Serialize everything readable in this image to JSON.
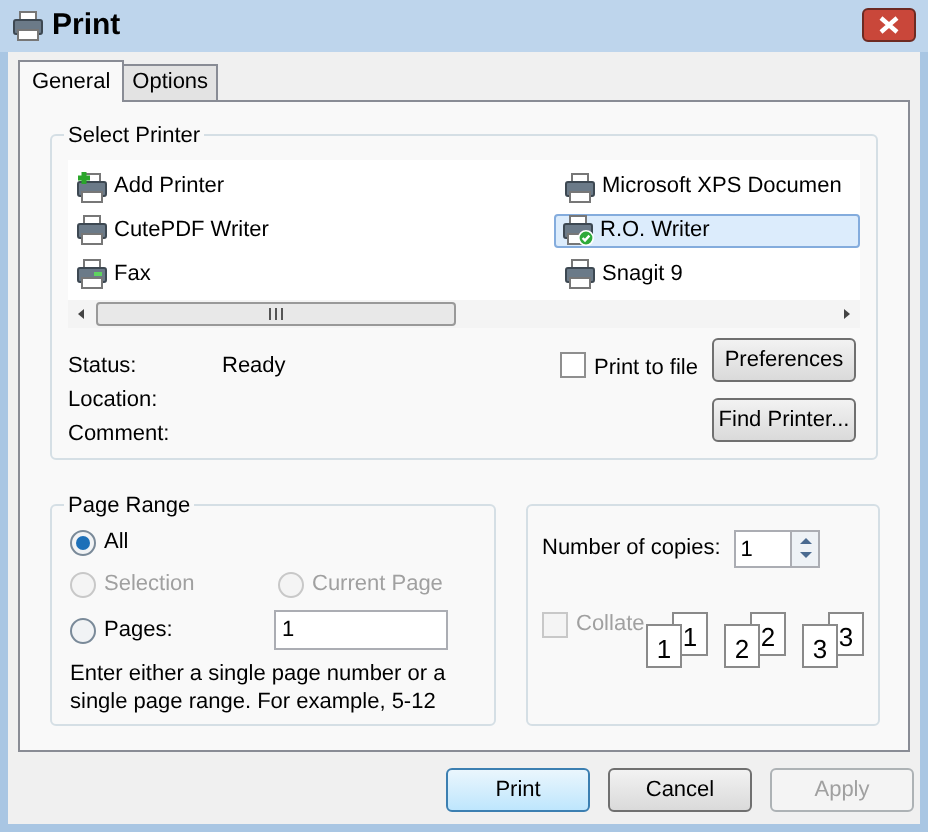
{
  "window": {
    "title": "Print"
  },
  "tabs": [
    {
      "label": "General",
      "selected": true
    },
    {
      "label": "Options",
      "selected": false
    }
  ],
  "select_printer": {
    "title": "Select Printer",
    "printers": [
      {
        "name": "Add Printer",
        "kind": "add",
        "selected": false,
        "default": false
      },
      {
        "name": "CutePDF Writer",
        "kind": "printer",
        "selected": false,
        "default": false
      },
      {
        "name": "Fax",
        "kind": "fax",
        "selected": false,
        "default": false
      },
      {
        "name": "Microsoft XPS Documen",
        "kind": "printer",
        "selected": false,
        "default": false
      },
      {
        "name": "R.O. Writer",
        "kind": "printer",
        "selected": true,
        "default": true
      },
      {
        "name": "Snagit 9",
        "kind": "printer",
        "selected": false,
        "default": false
      }
    ],
    "status": [
      {
        "label": "Status:",
        "value": "Ready"
      },
      {
        "label": "Location:"
      },
      {
        "label": "Comment:"
      }
    ],
    "print_to_file": {
      "label": "Print to file",
      "checked": false
    },
    "buttons": [
      "Preferences",
      "Find Printer..."
    ]
  },
  "page_range": {
    "title": "Page Range",
    "options": [
      {
        "label": "All",
        "selected": true,
        "disabled": false
      },
      {
        "label": "Selection",
        "selected": false,
        "disabled": true
      },
      {
        "label": "Current Page",
        "selected": false,
        "disabled": true
      },
      {
        "label": "Pages:",
        "selected": false,
        "disabled": false
      }
    ],
    "pages_value": "1",
    "hint": "Enter either a single page number or a single page range.  For example, 5-12"
  },
  "copies": {
    "label": "Number of copies:",
    "value": "1",
    "collate": {
      "label": "Collate",
      "checked": false,
      "disabled": true
    },
    "page_sets": [
      {
        "front": "1",
        "back": "1"
      },
      {
        "front": "2",
        "back": "2"
      },
      {
        "front": "3",
        "back": "3"
      }
    ]
  },
  "buttons": [
    {
      "label": "Print",
      "default": true,
      "disabled": false
    },
    {
      "label": "Cancel",
      "default": false,
      "disabled": false
    },
    {
      "label": "Apply",
      "default": false,
      "disabled": true
    }
  ]
}
